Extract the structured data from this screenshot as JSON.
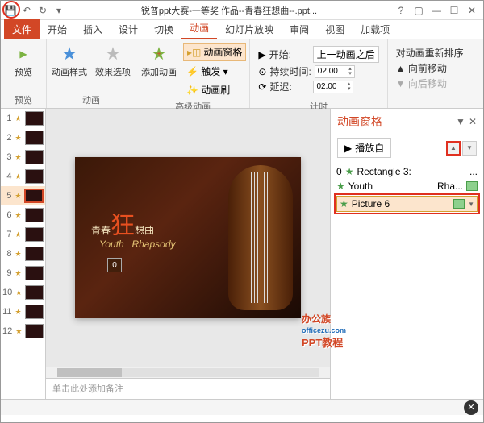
{
  "titlebar": {
    "title": "锐普ppt大赛-一等奖 作品--青春狂想曲--.ppt..."
  },
  "tabs": {
    "file": "文件",
    "home": "开始",
    "insert": "插入",
    "design": "设计",
    "trans": "切换",
    "anim": "动画",
    "slideshow": "幻灯片放映",
    "review": "审阅",
    "view": "视图",
    "addins": "加载项"
  },
  "ribbon": {
    "preview": "预览",
    "preview_grp": "预览",
    "anim_style": "动画样式",
    "effect_opts": "效果选项",
    "anim_grp": "动画",
    "add_anim": "添加动画",
    "anim_pane": "动画窗格",
    "trigger": "触发",
    "anim_painter": "动画刷",
    "adv_grp": "高级动画",
    "start_lbl": "开始:",
    "start_val": "上一动画之后",
    "duration_lbl": "持续时间:",
    "duration_val": "02.00",
    "delay_lbl": "延迟:",
    "delay_val": "02.00",
    "timing_grp": "计时",
    "reorder": "对动画重新排序",
    "move_up": "向前移动",
    "move_down": "向后移动"
  },
  "thumbs": [
    1,
    2,
    3,
    4,
    5,
    6,
    7,
    8,
    9,
    10,
    11,
    12
  ],
  "selected_thumb": 5,
  "slide": {
    "title_a": "青春",
    "title_b": "狂",
    "title_c": "想曲",
    "sub_a": "Youth",
    "sub_b": "Rhapsody",
    "num": "0"
  },
  "watermark": {
    "brand": "办公族",
    "url": "officezu.com",
    "tag": "PPT教程"
  },
  "notes": "单击此处添加备注",
  "pane": {
    "title": "动画窗格",
    "play": "播放自",
    "items": [
      {
        "idx": "0",
        "name": "Rectangle 3:",
        "extra": "..."
      },
      {
        "idx": "",
        "name": "Youth",
        "extra": "Rha..."
      },
      {
        "idx": "",
        "name": "Picture 6",
        "extra": ""
      }
    ]
  }
}
